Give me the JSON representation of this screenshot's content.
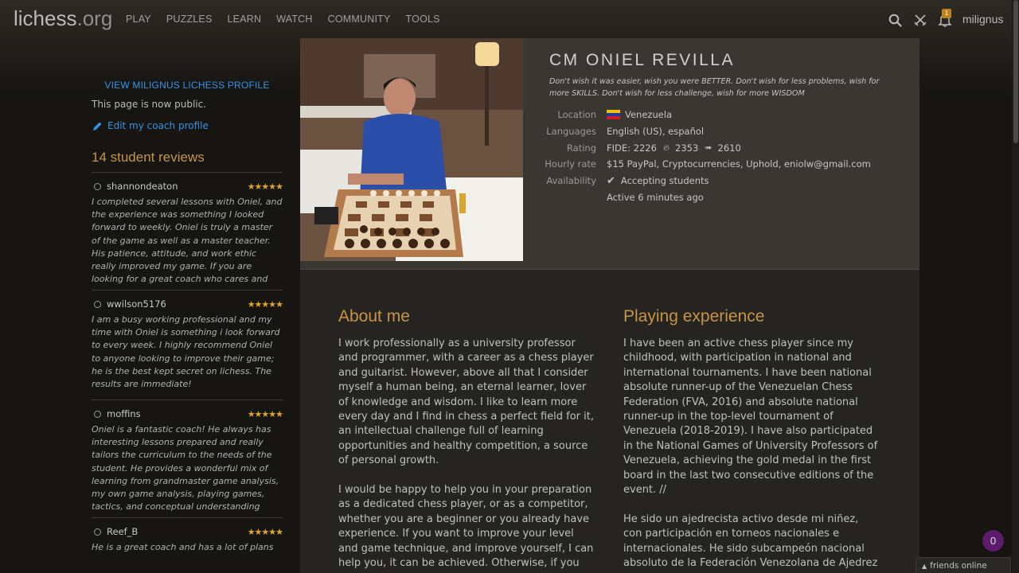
{
  "nav": {
    "logo_main": "lichess",
    "logo_tld": ".org",
    "menu": [
      "PLAY",
      "PUZZLES",
      "LEARN",
      "WATCH",
      "COMMUNITY",
      "TOOLS"
    ],
    "notification_count": "1",
    "username": "milignus"
  },
  "sidebar": {
    "view_profile": "VIEW MILIGNUS LICHESS PROFILE",
    "public_note": "This page is now public.",
    "edit_link": "Edit my coach profile",
    "reviews_title": "14 student reviews",
    "reviews": [
      {
        "name": "shannondeaton",
        "stars": "★★★★★",
        "text": "I completed several lessons with Oniel, and the experience was something I looked forward to weekly. Oniel is truly a master of the game as well as a master teacher. His patience, attitude, and work ethic really improved my game. If you are looking for a great coach who cares and wants to see you improve, look no further than Oniel. I highly"
      },
      {
        "name": "wwilson5176",
        "stars": "★★★★★",
        "text": "I am a busy working professional and my time with Oniel is something i look forward to every week. I highly recommend Oniel to anyone looking to improve their game; he is the best kept secret on lichess. The results are immediate!"
      },
      {
        "name": "moffins",
        "stars": "★★★★★",
        "text": "Oniel is a fantastic coach! He always has interesting lessons prepared and really tailors the curriculum to the needs of the student. He provides a wonderful mix of learning from grandmaster game analysis, my own game analysis, playing games, tactics, and conceptual understanding exercises. Furthermore, he is very flexible"
      },
      {
        "name": "Reef_B",
        "stars": "★★★★★",
        "text": "He is a great coach and has a lot of plans"
      }
    ]
  },
  "coach": {
    "title": "CM ONIEL REVILLA",
    "quote": "Don't wish it was easier, wish you were BETTER. Don't wish for less problems, wish for more SKILLS. Don't wish for less challenge, wish for more WISDOM",
    "location_label": "Location",
    "location": "Venezuela",
    "languages_label": "Languages",
    "languages": "English (US), español",
    "rating_label": "Rating",
    "rating_fide": "FIDE: 2226",
    "rating_blitz": "2353",
    "rating_bullet": "2610",
    "hourly_label": "Hourly rate",
    "hourly": "$15 PayPal, Cryptocurrencies, Uphold, eniolw@gmail.com",
    "availability_label": "Availability",
    "availability": "Accepting students",
    "active": "Active 6 minutes ago"
  },
  "about": {
    "title": "About me",
    "p1": "I work professionally as a university professor and programmer, with a career as a chess player and guitarist. However, above all that I consider myself a human being, an eternal learner, lover of knowledge and wisdom. I like to learn more every day and I find in chess a perfect field for it, an intellectual challenge full of learning opportunities and healthy competition, a source of personal growth.",
    "p2": "I would be happy to help you in your preparation as a dedicated chess player, or as a competitor, whether you are a beginner or you already have experience. If you want to improve your level and game technique, and improve yourself, I can help you, it can be achieved. Otherwise, if you are"
  },
  "experience": {
    "title": "Playing experience",
    "p1": "I have been an active chess player since my childhood, with participation in national and international tournaments. I have been national absolute runner-up of the Venezuelan Chess Federation (FVA, 2016) and absolute national runner-up in the top-level tournament of Venezuela (2018-2019). I have also participated in the National Games of University Professors of Venezuela, achieving the gold medal in the first board in the last two consecutive editions of the event. //",
    "p2": "He sido un ajedrecista activo desde mi niñez, con participación en torneos nacionales e internacionales. He sido subcampeón nacional absoluto de la Federación Venezolana de Ajedrez"
  },
  "footer": {
    "friends": "friends online",
    "badge": "0"
  }
}
